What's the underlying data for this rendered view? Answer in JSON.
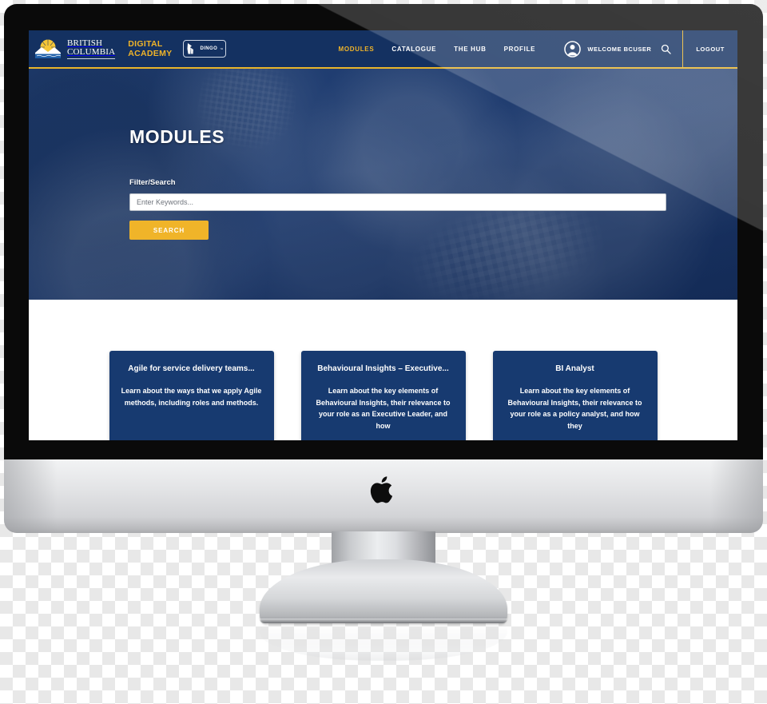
{
  "device": {
    "type": "imac-desktop-monitor",
    "brand_logo": "apple-logo"
  },
  "site": {
    "brand": {
      "bc_logo_line1": "British",
      "bc_logo_line2": "Columbia",
      "program_line1": "DIGITAL",
      "program_line2": "ACADEMY",
      "partner_name": "DINGO",
      "partner_tm": "™"
    },
    "nav": [
      {
        "label": "MODULES",
        "active": true
      },
      {
        "label": "CATALOGUE",
        "active": false
      },
      {
        "label": "THE HUB",
        "active": false
      },
      {
        "label": "PROFILE",
        "active": false
      }
    ],
    "user": {
      "welcome_label": "WELCOME BCUSER",
      "logout_label": "LOGOUT",
      "avatar_icon": "user-avatar-icon",
      "search_icon": "search-icon"
    }
  },
  "hero": {
    "title": "MODULES",
    "filter_label": "Filter/Search",
    "search_placeholder": "Enter Keywords...",
    "search_value": "",
    "search_button_label": "SEARCH"
  },
  "cards": [
    {
      "title": "Agile for service delivery teams...",
      "description": "Learn about the ways that we apply Agile methods, including roles and methods."
    },
    {
      "title": "Behavioural Insights – Executive...",
      "description": "Learn about the key elements of Behavioural Insights, their relevance to your role as an Executive Leader, and how"
    },
    {
      "title": "BI Analyst",
      "description": "Learn about the key elements of Behavioural Insights, their relevance to your role as a policy analyst, and how they"
    }
  ],
  "colors": {
    "header_blue": "#143161",
    "accent_gold": "#f0b429",
    "card_blue": "#173a70",
    "hero_blue": "#2f4f86",
    "bezel_black": "#0a0a0a",
    "chin_silver": "#e3e4e6"
  }
}
